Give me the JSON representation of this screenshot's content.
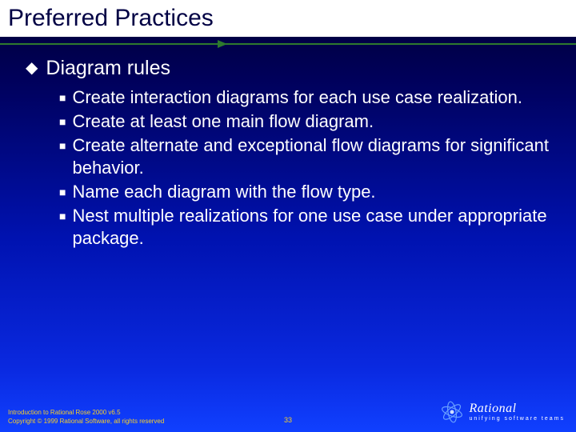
{
  "title": "Preferred Practices",
  "section": {
    "heading": "Diagram rules",
    "bullets": [
      "Create interaction diagrams for each use case realization.",
      "Create at least one main flow diagram.",
      "Create alternate and exceptional flow diagrams for significant behavior.",
      "Name each diagram with the flow type.",
      "Nest multiple realizations for one use case under appropriate package."
    ]
  },
  "footer": {
    "line1": "Introduction to Rational Rose 2000 v6.5",
    "line2": "Copyright © 1999 Rational Software, all rights reserved"
  },
  "page_number": "33",
  "logo": {
    "brand": "Rational",
    "tagline": "unifying software teams"
  }
}
